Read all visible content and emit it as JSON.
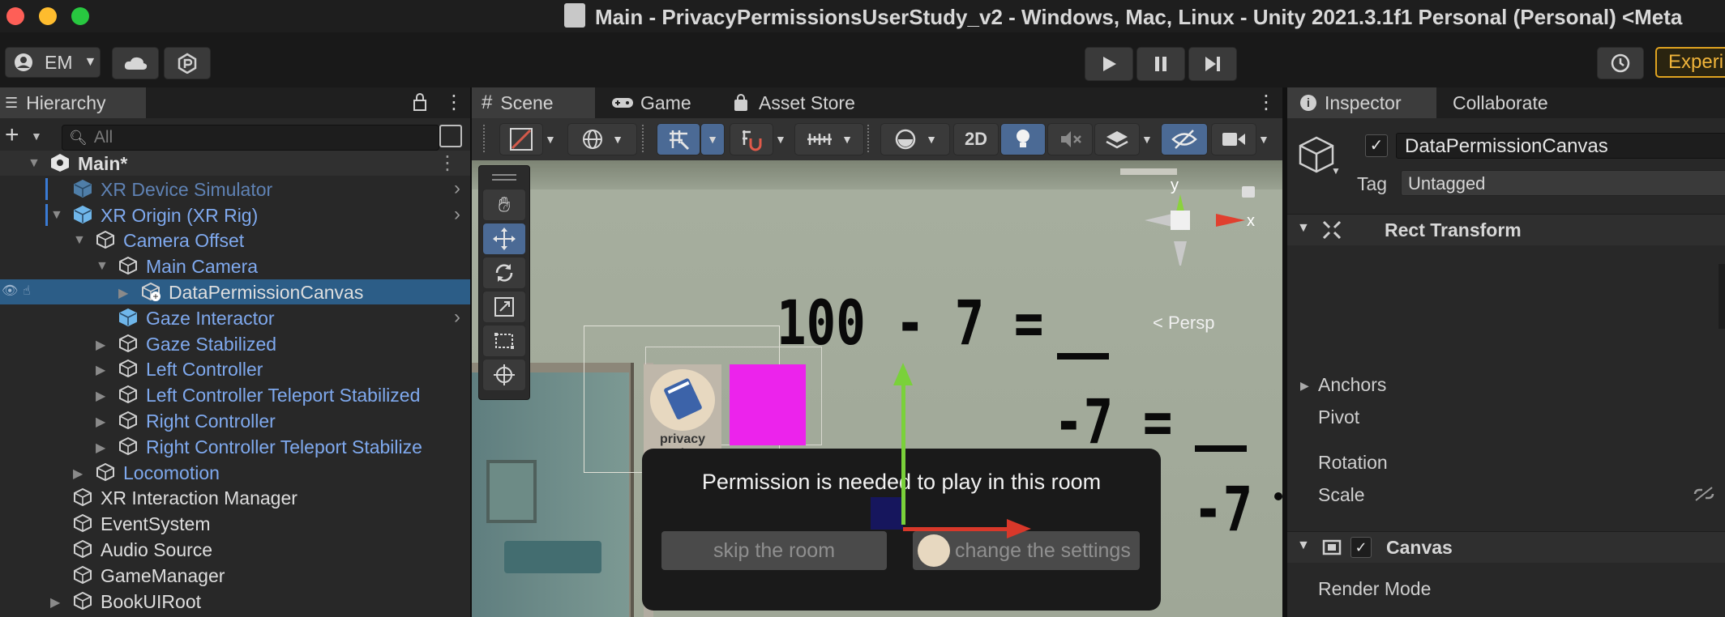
{
  "window": {
    "title": "Main - PrivacyPermissionsUserStudy_v2 - Windows, Mac, Linux - Unity 2021.3.1f1 Personal (Personal) <Meta",
    "traffic_colors": [
      "#fe5f57",
      "#febc2e",
      "#28c840"
    ]
  },
  "toolbar": {
    "account_label": "EM",
    "experimental_label": "Experi"
  },
  "hierarchy": {
    "tab_label": "Hierarchy",
    "search_placeholder": "All",
    "items": [
      {
        "label": "Main*",
        "color": "white",
        "indent": 0,
        "expanded": "open",
        "icon": "unity-scene-icon",
        "menu": true,
        "bold": true
      },
      {
        "label": "XR Device Simulator",
        "color": "dim",
        "indent": 1,
        "expanded": "",
        "icon": "prefab-cube-icon",
        "chevron": true
      },
      {
        "label": "XR Origin (XR Rig)",
        "color": "blue",
        "indent": 1,
        "expanded": "open",
        "icon": "prefab-cube-icon",
        "chevron": true
      },
      {
        "label": "Camera Offset",
        "color": "blue",
        "indent": 2,
        "expanded": "open",
        "icon": "gameobject-cube-icon"
      },
      {
        "label": "Main Camera",
        "color": "blue",
        "indent": 3,
        "expanded": "open",
        "icon": "gameobject-cube-icon"
      },
      {
        "label": "DataPermissionCanvas",
        "color": "white",
        "indent": 4,
        "expanded": "closed",
        "icon": "gameobject-cube-icon",
        "selected": true
      },
      {
        "label": "Gaze Interactor",
        "color": "blue",
        "indent": 3,
        "expanded": "",
        "icon": "prefab-cube-icon",
        "chevron": true
      },
      {
        "label": "Gaze Stabilized",
        "color": "blue",
        "indent": 3,
        "expanded": "closed",
        "icon": "gameobject-cube-icon"
      },
      {
        "label": "Left Controller",
        "color": "blue",
        "indent": 3,
        "expanded": "closed",
        "icon": "gameobject-cube-icon"
      },
      {
        "label": "Left Controller Teleport Stabilized",
        "color": "blue",
        "indent": 3,
        "expanded": "closed",
        "icon": "gameobject-cube-icon"
      },
      {
        "label": "Right Controller",
        "color": "blue",
        "indent": 3,
        "expanded": "closed",
        "icon": "gameobject-cube-icon"
      },
      {
        "label": "Right Controller Teleport Stabilize",
        "color": "blue",
        "indent": 3,
        "expanded": "closed",
        "icon": "gameobject-cube-icon"
      },
      {
        "label": "Locomotion",
        "color": "blue",
        "indent": 2,
        "expanded": "closed",
        "icon": "gameobject-cube-icon"
      },
      {
        "label": "XR Interaction Manager",
        "color": "white",
        "indent": 1,
        "expanded": "",
        "icon": "gameobject-cube-icon"
      },
      {
        "label": "EventSystem",
        "color": "white",
        "indent": 1,
        "expanded": "",
        "icon": "gameobject-cube-icon"
      },
      {
        "label": "Audio Source",
        "color": "white",
        "indent": 1,
        "expanded": "",
        "icon": "gameobject-cube-icon"
      },
      {
        "label": "GameManager",
        "color": "white",
        "indent": 1,
        "expanded": "",
        "icon": "gameobject-cube-icon"
      },
      {
        "label": "BookUIRoot",
        "color": "white",
        "indent": 1,
        "expanded": "closed",
        "icon": "gameobject-cube-icon"
      }
    ]
  },
  "scene_tabs": {
    "scene_label": "Scene",
    "game_label": "Game",
    "asset_store_label": "Asset Store"
  },
  "scene_toolbar": {
    "two_d_label": "2D"
  },
  "scene_view": {
    "math_line1": "100 - 7 =",
    "math_line2": "-7 =",
    "math_line3": "-7",
    "persp_label": "< Persp",
    "gizmo_y": "y",
    "gizmo_x": "x",
    "privacy_label": "privacy settings",
    "dialog_title": "Permission is needed to play in this room",
    "skip_button": "skip the room",
    "change_button": "change the settings"
  },
  "inspector": {
    "tab_label": "Inspector",
    "collaborate_label": "Collaborate",
    "object_name": "DataPermissionCanvas",
    "tag_label": "Tag",
    "tag_value": "Untagged",
    "rect_transform_label": "Rect Transform",
    "anchors_label": "Anchors",
    "pivot_label": "Pivot",
    "rotation_label": "Rotation",
    "scale_label": "Scale",
    "canvas_label": "Canvas",
    "render_mode_label": "Render Mode"
  }
}
